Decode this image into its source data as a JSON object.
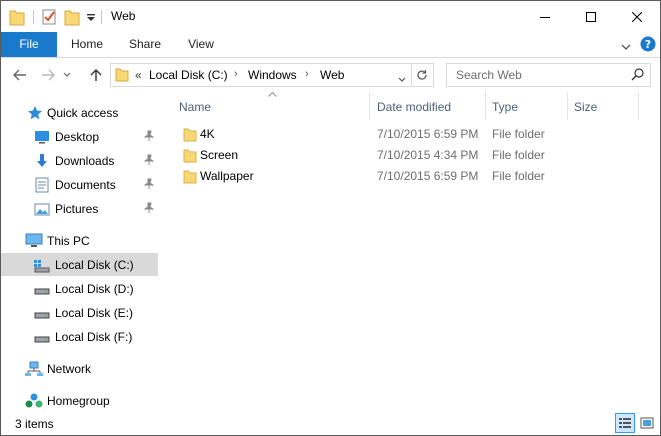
{
  "window": {
    "title": "Web"
  },
  "ribbon": {
    "tabs": [
      {
        "label": "File"
      },
      {
        "label": "Home"
      },
      {
        "label": "Share"
      },
      {
        "label": "View"
      }
    ]
  },
  "address": {
    "overflow": "«",
    "parts": [
      "Local Disk (C:)",
      "Windows",
      "Web"
    ]
  },
  "search": {
    "placeholder": "Search Web"
  },
  "nav": {
    "quick_access": "Quick access",
    "items": [
      "Desktop",
      "Downloads",
      "Documents",
      "Pictures"
    ],
    "this_pc": "This PC",
    "drives": [
      "Local Disk (C:)",
      "Local Disk (D:)",
      "Local Disk (E:)",
      "Local Disk (F:)"
    ],
    "network": "Network",
    "homegroup": "Homegroup"
  },
  "columns": {
    "name": "Name",
    "date": "Date modified",
    "type": "Type",
    "size": "Size"
  },
  "files": [
    {
      "name": "4K",
      "date": "7/10/2015 6:59 PM",
      "type": "File folder"
    },
    {
      "name": "Screen",
      "date": "7/10/2015 4:34 PM",
      "type": "File folder"
    },
    {
      "name": "Wallpaper",
      "date": "7/10/2015 6:59 PM",
      "type": "File folder"
    }
  ],
  "status": {
    "count": "3 items"
  },
  "colors": {
    "accent": "#1979ca",
    "selected_nav": "#d9d9d9",
    "folder": "#f8d775",
    "header_text": "#4c607a"
  }
}
